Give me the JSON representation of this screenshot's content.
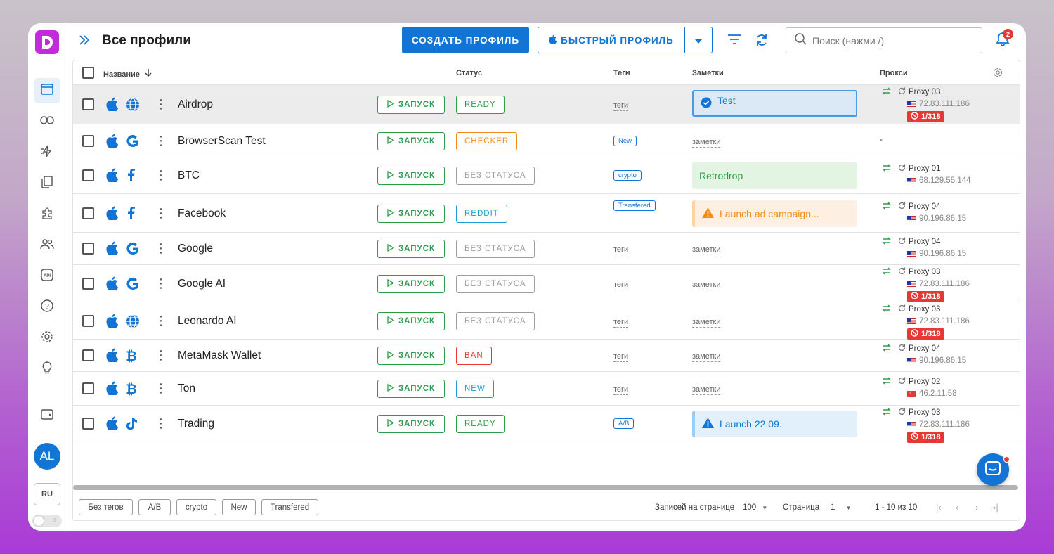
{
  "header": {
    "title": "Все профили",
    "create_label": "СОЗДАТЬ ПРОФИЛЬ",
    "quick_label": "БЫСТРЫЙ ПРОФИЛЬ",
    "search_placeholder": "Поиск (нажми /)",
    "notifications_count": "2"
  },
  "sidebar": {
    "user_initials": "AL",
    "language": "RU",
    "items": [
      "browser-icon",
      "link-icon",
      "automation-icon",
      "copy-icon",
      "extensions-icon",
      "team-icon",
      "api-icon",
      "help-icon",
      "settings-icon",
      "idea-icon",
      "wallet-icon"
    ]
  },
  "table": {
    "columns": {
      "name": "Название",
      "status": "Статус",
      "tags": "Теги",
      "notes": "Заметки",
      "proxy": "Прокси"
    },
    "run_label": "ЗАПУСК",
    "tags_placeholder": "теги",
    "notes_placeholder": "заметки",
    "rows": [
      {
        "name": "Airdrop",
        "app_icon": "globe-icon",
        "status": "READY",
        "tag": "",
        "note": "Test",
        "proxy": "Proxy 03",
        "ip": "72.83.111.186",
        "blocked": "1/318"
      },
      {
        "name": "BrowserScan Test",
        "app_icon": "google-icon",
        "status": "CHECKER",
        "tag": "New",
        "note": "",
        "proxy": "-",
        "ip": "",
        "blocked": ""
      },
      {
        "name": "BTC",
        "app_icon": "facebook-icon",
        "status": "БЕЗ СТАТУСА",
        "tag": "crypto",
        "note": "Retrodrop",
        "proxy": "Proxy 01",
        "ip": "68.129.55.144",
        "blocked": ""
      },
      {
        "name": "Facebook",
        "app_icon": "facebook-icon",
        "status": "REDDIT",
        "tag": "Transfered",
        "note": "Launch ad campaign...",
        "proxy": "Proxy 04",
        "ip": "90.196.86.15",
        "blocked": ""
      },
      {
        "name": "Google",
        "app_icon": "google-icon",
        "status": "БЕЗ СТАТУСА",
        "tag": "",
        "note": "",
        "proxy": "Proxy 04",
        "ip": "90.196.86.15",
        "blocked": ""
      },
      {
        "name": "Google AI",
        "app_icon": "google-icon",
        "status": "БЕЗ СТАТУСА",
        "tag": "",
        "note": "",
        "proxy": "Proxy 03",
        "ip": "72.83.111.186",
        "blocked": "1/318"
      },
      {
        "name": "Leonardo AI",
        "app_icon": "globe-icon",
        "status": "БЕЗ СТАТУСА",
        "tag": "",
        "note": "",
        "proxy": "Proxy 03",
        "ip": "72.83.111.186",
        "blocked": "1/318"
      },
      {
        "name": "MetaMask Wallet",
        "app_icon": "bitcoin-icon",
        "status": "BAN",
        "tag": "",
        "note": "",
        "proxy": "Proxy 04",
        "ip": "90.196.86.15",
        "blocked": ""
      },
      {
        "name": "Ton",
        "app_icon": "bitcoin-icon",
        "status": "NEW",
        "tag": "",
        "note": "",
        "proxy": "Proxy 02",
        "ip": "46.2.11.58",
        "blocked": ""
      },
      {
        "name": "Trading",
        "app_icon": "tiktok-icon",
        "status": "READY",
        "tag": "A/B",
        "note": "Launch 22.09.",
        "proxy": "Proxy 03",
        "ip": "72.83.111.186",
        "blocked": "1/318"
      }
    ]
  },
  "footer": {
    "tags": [
      "Без тегов",
      "A/B",
      "crypto",
      "New",
      "Transfered"
    ],
    "per_page_label": "Записей на странице",
    "per_page_value": "100",
    "page_label": "Страница",
    "page_value": "1",
    "range": "1 - 10 из 10"
  },
  "colors": {
    "primary": "#1275d6",
    "green": "#2e9d4b",
    "red": "#e53935",
    "orange": "#f28c18",
    "reddit": "#1a9fd6",
    "gray": "#9e9e9e",
    "brand": "#c22bd9"
  }
}
